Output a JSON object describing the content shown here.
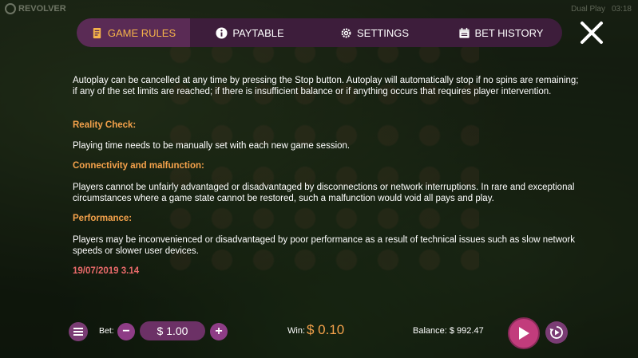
{
  "brand": {
    "name": "REVOLVER"
  },
  "status": {
    "left": "Dual Play",
    "right": "03:18"
  },
  "tabs": [
    {
      "label": "GAME RULES",
      "icon": "document-icon",
      "active": true
    },
    {
      "label": "PAYTABLE",
      "icon": "info-icon",
      "active": false
    },
    {
      "label": "SETTINGS",
      "icon": "gear-icon",
      "active": false
    },
    {
      "label": "BET HISTORY",
      "icon": "calendar-icon",
      "active": false
    }
  ],
  "rules": {
    "para_autoplay": "Autoplay can be cancelled at any time by pressing the Stop button. Autoplay will automatically stop if no spins are remaining; if any of the set limits are reached; if there is insufficient balance or if anything occurs that requires player intervention.",
    "heading_reality": "Reality Check:",
    "para_reality": "Playing time needs to be manually set with each new game session.",
    "heading_connectivity": "Connectivity and malfunction:",
    "para_connectivity": "Players cannot be unfairly advantaged or disadvantaged by disconnections or network interruptions. In rare and exceptional circumstances where a game state cannot be restored, such a malfunction would void all pays and play.",
    "heading_performance": "Performance:",
    "para_performance": "Players may be inconvenienced or disadvantaged by poor performance as a result of technical issues such as slow network speeds or slower user devices.",
    "version": "19/07/2019 3.14"
  },
  "bottom": {
    "bet_label": "Bet:",
    "bet_value": "$ 1.00",
    "minus": "−",
    "plus": "+",
    "win_label": "Win:",
    "win_value": "$ 0.10",
    "balance": "Balance: $ 992.47"
  },
  "colors": {
    "accent": "#f5a24b",
    "tabbar": "#3d1d3b",
    "version": "#e96a6a",
    "button": "#8e3d86",
    "spin": "#c23c7c"
  }
}
